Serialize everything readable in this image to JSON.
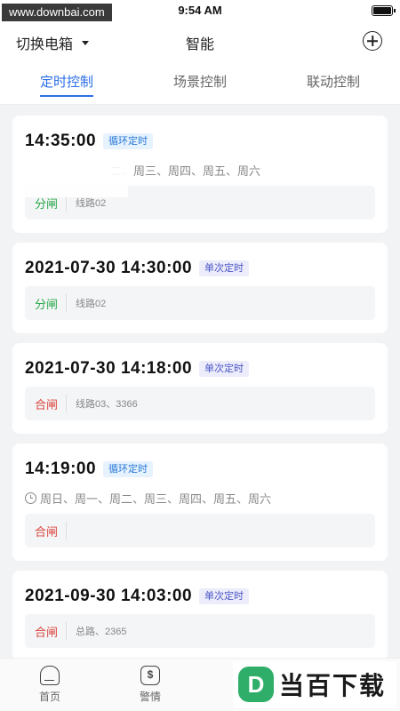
{
  "status_bar": {
    "watermark": "www.downbai.com",
    "time": "9:54 AM"
  },
  "nav": {
    "switch_label": "切换电箱",
    "title": "智能"
  },
  "tabs": [
    {
      "label": "定时控制",
      "active": true
    },
    {
      "label": "场景控制",
      "active": false
    },
    {
      "label": "联动控制",
      "active": false
    }
  ],
  "cards": [
    {
      "time": "14:35:00",
      "badge": "循环定时",
      "days": "二、周三、周四、周五、周六",
      "action": "分闸",
      "lines": "线路02"
    },
    {
      "time": "2021-07-30 14:30:00",
      "badge": "单次定时",
      "action": "分闸",
      "lines": "线路02"
    },
    {
      "time": "2021-07-30 14:18:00",
      "badge": "单次定时",
      "action": "合闸",
      "lines": "线路03、3366"
    },
    {
      "time": "14:19:00",
      "badge": "循环定时",
      "days": "周日、周一、周二、周三、周四、周五、周六",
      "action": "合闸",
      "lines": ""
    },
    {
      "time": "2021-09-30 14:03:00",
      "badge": "单次定时",
      "action": "合闸",
      "lines": "总路、2365"
    }
  ],
  "bottom_nav": {
    "home_label": "首页",
    "alarm_label": "警情"
  },
  "logo": {
    "mark": "D",
    "name": "当百下载"
  }
}
